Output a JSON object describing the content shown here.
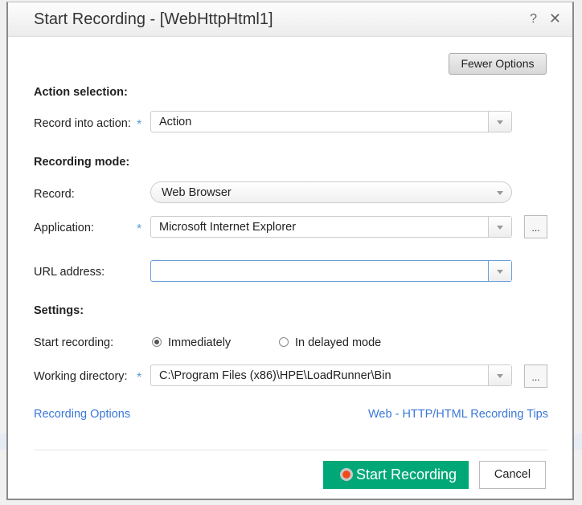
{
  "dialog": {
    "title": "Start Recording - [WebHttpHtml1]",
    "help": "?",
    "close": "✕"
  },
  "fewer_options": "Fewer Options",
  "action_selection": {
    "heading": "Action selection:",
    "record_into_label": "Record into action:",
    "record_into_value": "Action"
  },
  "recording_mode": {
    "heading": "Recording mode:",
    "record_label": "Record:",
    "record_value": "Web Browser",
    "application_label": "Application:",
    "application_value": "Microsoft Internet Explorer",
    "url_label": "URL address:",
    "url_value": ""
  },
  "settings": {
    "heading": "Settings:",
    "start_label": "Start recording:",
    "options": [
      "Immediately",
      "In delayed mode"
    ],
    "selected": "Immediately",
    "workdir_label": "Working directory:",
    "workdir_value": "C:\\Program Files (x86)\\HPE\\LoadRunner\\Bin"
  },
  "browse": "...",
  "links": {
    "recording_options": "Recording Options",
    "tips": "Web - HTTP/HTML Recording Tips"
  },
  "buttons": {
    "start": "Start Recording",
    "cancel": "Cancel"
  },
  "colors": {
    "accent": "#00a878",
    "link": "#3a78d8",
    "required": "#5b9bd5"
  }
}
